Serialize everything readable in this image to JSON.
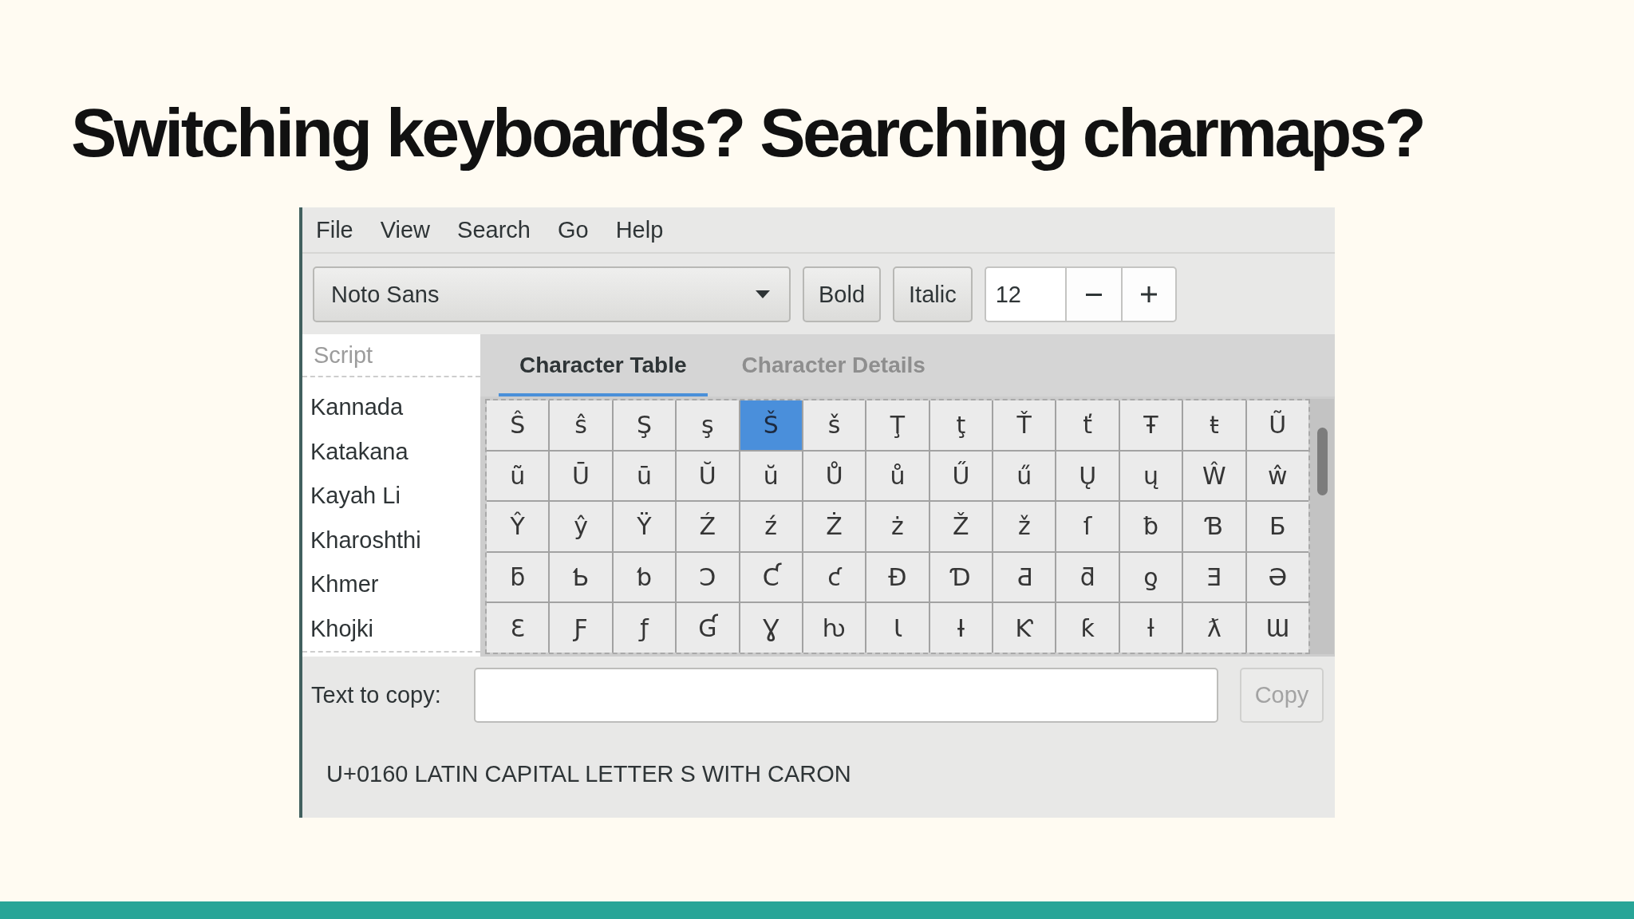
{
  "slide_title": "Switching keyboards? Searching charmaps?",
  "window": {
    "menu": [
      "File",
      "View",
      "Search",
      "Go",
      "Help"
    ],
    "toolbar": {
      "font_family": {
        "value": "Noto Sans"
      },
      "style_buttons": [
        {
          "label": "Bold"
        },
        {
          "label": "Italic"
        }
      ],
      "font_size": {
        "value": "12"
      }
    },
    "script_list": {
      "header": "Script",
      "items": [
        {
          "label": "Kannada",
          "selected": false
        },
        {
          "label": "Katakana",
          "selected": false
        },
        {
          "label": "Kayah Li",
          "selected": false
        },
        {
          "label": "Kharoshthi",
          "selected": false
        },
        {
          "label": "Khmer",
          "selected": false
        },
        {
          "label": "Khojki",
          "selected": false
        }
      ]
    },
    "tabs": [
      {
        "label": "Character Table",
        "selected": true
      },
      {
        "label": "Character Details",
        "selected": false
      }
    ],
    "character_grid": {
      "rows": [
        {
          "cells": [
            {
              "char": "Ŝ",
              "selected": false
            },
            {
              "char": "ŝ",
              "selected": false
            },
            {
              "char": "Ş",
              "selected": false
            },
            {
              "char": "ş",
              "selected": false
            },
            {
              "char": "Š",
              "selected": true
            },
            {
              "char": "š",
              "selected": false
            },
            {
              "char": "Ţ",
              "selected": false
            },
            {
              "char": "ţ",
              "selected": false
            },
            {
              "char": "Ť",
              "selected": false
            },
            {
              "char": "ť",
              "selected": false
            },
            {
              "char": "Ŧ",
              "selected": false
            },
            {
              "char": "ŧ",
              "selected": false
            },
            {
              "char": "Ũ",
              "selected": false
            }
          ]
        },
        {
          "cells": [
            {
              "char": "ũ",
              "selected": false
            },
            {
              "char": "Ū",
              "selected": false
            },
            {
              "char": "ū",
              "selected": false
            },
            {
              "char": "Ŭ",
              "selected": false
            },
            {
              "char": "ŭ",
              "selected": false
            },
            {
              "char": "Ů",
              "selected": false
            },
            {
              "char": "ů",
              "selected": false
            },
            {
              "char": "Ű",
              "selected": false
            },
            {
              "char": "ű",
              "selected": false
            },
            {
              "char": "Ų",
              "selected": false
            },
            {
              "char": "ų",
              "selected": false
            },
            {
              "char": "Ŵ",
              "selected": false
            },
            {
              "char": "ŵ",
              "selected": false
            }
          ]
        },
        {
          "cells": [
            {
              "char": "Ŷ",
              "selected": false
            },
            {
              "char": "ŷ",
              "selected": false
            },
            {
              "char": "Ÿ",
              "selected": false
            },
            {
              "char": "Ź",
              "selected": false
            },
            {
              "char": "ź",
              "selected": false
            },
            {
              "char": "Ż",
              "selected": false
            },
            {
              "char": "ż",
              "selected": false
            },
            {
              "char": "Ž",
              "selected": false
            },
            {
              "char": "ž",
              "selected": false
            },
            {
              "char": "ſ",
              "selected": false
            },
            {
              "char": "ƀ",
              "selected": false
            },
            {
              "char": "Ɓ",
              "selected": false
            },
            {
              "char": "Ƃ",
              "selected": false
            }
          ]
        },
        {
          "cells": [
            {
              "char": "ƃ",
              "selected": false
            },
            {
              "char": "Ƅ",
              "selected": false
            },
            {
              "char": "ƅ",
              "selected": false
            },
            {
              "char": "Ɔ",
              "selected": false
            },
            {
              "char": "Ƈ",
              "selected": false
            },
            {
              "char": "ƈ",
              "selected": false
            },
            {
              "char": "Ɖ",
              "selected": false
            },
            {
              "char": "Ɗ",
              "selected": false
            },
            {
              "char": "Ƌ",
              "selected": false
            },
            {
              "char": "ƌ",
              "selected": false
            },
            {
              "char": "ƍ",
              "selected": false
            },
            {
              "char": "Ǝ",
              "selected": false
            },
            {
              "char": "Ə",
              "selected": false
            }
          ]
        },
        {
          "cells": [
            {
              "char": "Ɛ",
              "selected": false
            },
            {
              "char": "Ƒ",
              "selected": false
            },
            {
              "char": "ƒ",
              "selected": false
            },
            {
              "char": "Ɠ",
              "selected": false
            },
            {
              "char": "Ɣ",
              "selected": false
            },
            {
              "char": "ƕ",
              "selected": false
            },
            {
              "char": "Ɩ",
              "selected": false
            },
            {
              "char": "Ɨ",
              "selected": false
            },
            {
              "char": "Ƙ",
              "selected": false
            },
            {
              "char": "ƙ",
              "selected": false
            },
            {
              "char": "ƚ",
              "selected": false
            },
            {
              "char": "ƛ",
              "selected": false
            },
            {
              "char": "Ɯ",
              "selected": false
            }
          ]
        }
      ]
    },
    "copy_field": {
      "label": "Text to copy:"
    },
    "copy_button": {
      "label": "Copy",
      "disabled": true
    },
    "status": "U+0160 LATIN CAPITAL LETTER S WITH CARON"
  }
}
